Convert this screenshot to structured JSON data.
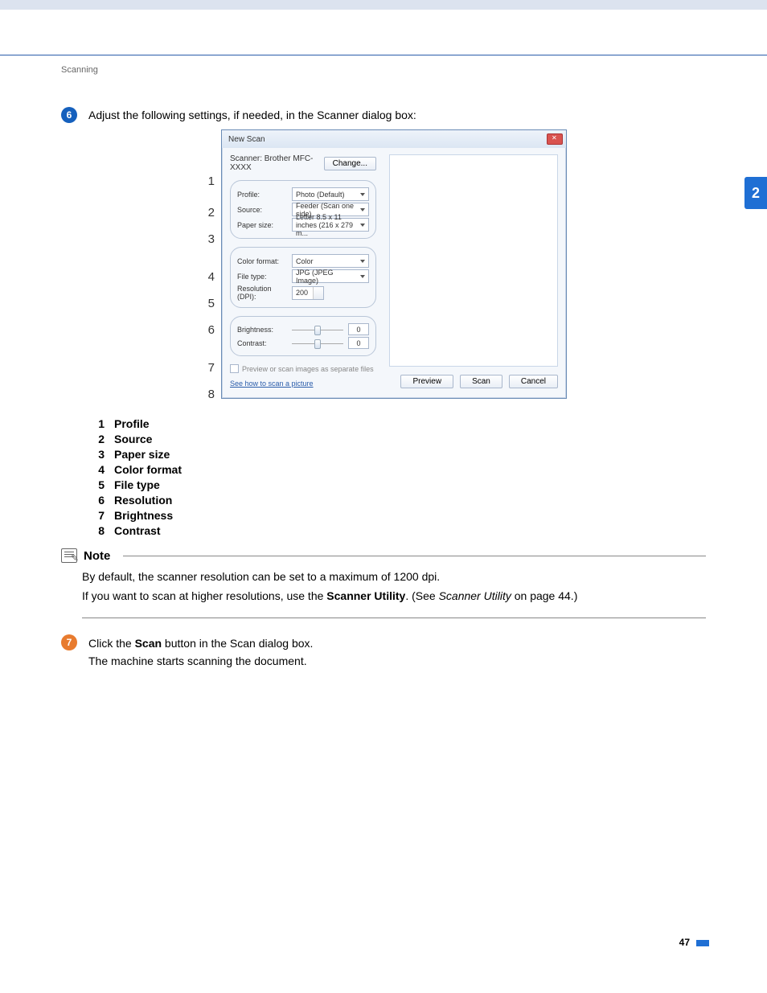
{
  "section_label": "Scanning",
  "side_tab": "2",
  "page_number": "47",
  "step6": {
    "badge": "6",
    "text": "Adjust the following settings, if needed, in the Scanner dialog box:"
  },
  "callouts": [
    "1",
    "2",
    "3",
    "4",
    "5",
    "6",
    "7",
    "8"
  ],
  "dialog": {
    "title": "New Scan",
    "scanner_label": "Scanner: Brother MFC- XXXX",
    "change_btn": "Change...",
    "profile_label": "Profile:",
    "profile_value": "Photo (Default)",
    "source_label": "Source:",
    "source_value": "Feeder (Scan one side)",
    "paper_label": "Paper size:",
    "paper_value": "Letter 8.5 x 11 inches (216 x 279 m...",
    "color_label": "Color format:",
    "color_value": "Color",
    "file_label": "File type:",
    "file_value": "JPG (JPEG Image)",
    "res_label": "Resolution (DPI):",
    "res_value": "200",
    "bright_label": "Brightness:",
    "bright_value": "0",
    "contrast_label": "Contrast:",
    "contrast_value": "0",
    "chk_label": "Preview or scan images as separate files",
    "help_link": "See how to scan a picture",
    "preview_btn": "Preview",
    "scan_btn": "Scan",
    "cancel_btn": "Cancel"
  },
  "legend": [
    {
      "n": "1",
      "label": "Profile"
    },
    {
      "n": "2",
      "label": "Source"
    },
    {
      "n": "3",
      "label": "Paper size"
    },
    {
      "n": "4",
      "label": "Color format"
    },
    {
      "n": "5",
      "label": "File type"
    },
    {
      "n": "6",
      "label": "Resolution"
    },
    {
      "n": "7",
      "label": "Brightness"
    },
    {
      "n": "8",
      "label": "Contrast"
    }
  ],
  "note": {
    "title": "Note",
    "line1": "By default, the scanner resolution can be set to a maximum of 1200 dpi.",
    "line2_a": "If you want to scan at higher resolutions, use the ",
    "line2_b": "Scanner Utility",
    "line2_c": ". (See ",
    "line2_d": "Scanner Utility",
    "line2_e": " on page 44.)"
  },
  "step7": {
    "badge": "7",
    "line1_a": "Click the ",
    "line1_b": "Scan",
    "line1_c": " button in the Scan dialog box.",
    "line2": "The machine starts scanning the document."
  }
}
